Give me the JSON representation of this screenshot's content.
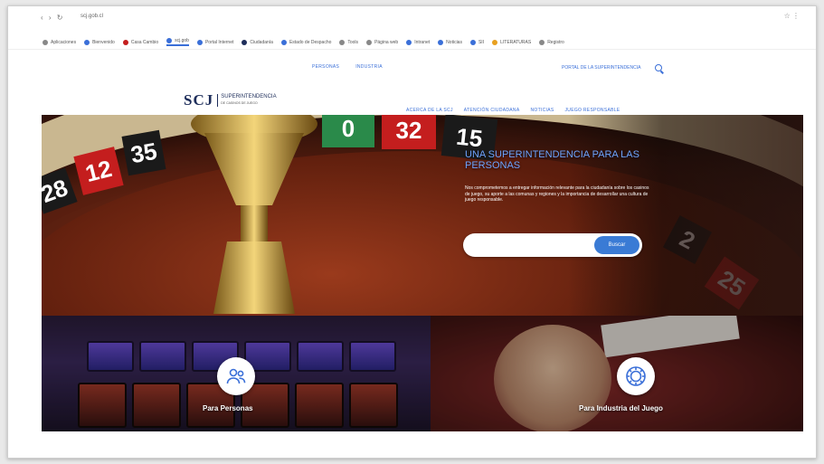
{
  "browser": {
    "nav_glyphs": "‹ › ↻",
    "url": "scj.gob.cl",
    "right_glyphs": "☆ ⋮",
    "bookmarks": [
      {
        "label": "Aplicaciones",
        "color": "#888888"
      },
      {
        "label": "Bienvenido",
        "color": "#3a6fd8"
      },
      {
        "label": "Casa Cambio",
        "color": "#c41e1e"
      },
      {
        "label": "scj.gob",
        "color": "#3a6fd8",
        "active": true
      },
      {
        "label": "Portal Internet",
        "color": "#3a6fd8"
      },
      {
        "label": "Ciudadanía",
        "color": "#1d2d5a"
      },
      {
        "label": "Estado de Despacho",
        "color": "#3a6fd8"
      },
      {
        "label": "Tools",
        "color": "#888888"
      },
      {
        "label": "Página web",
        "color": "#888888"
      },
      {
        "label": "Intranet",
        "color": "#3a6fd8"
      },
      {
        "label": "Noticias",
        "color": "#3a6fd8"
      },
      {
        "label": "SII",
        "color": "#3a6fd8"
      },
      {
        "label": "LITERATURAS",
        "color": "#e8a020"
      },
      {
        "label": "Registro",
        "color": "#888888"
      }
    ]
  },
  "header": {
    "topnav": [
      "PERSONAS",
      "INDUSTRIA"
    ],
    "topnav_right": "PORTAL DE LA SUPERINTENDENCIA",
    "logo_mark": "SCJ",
    "logo_text": "SUPERINTENDENCIA",
    "logo_sub": "DE CASINOS DE JUEGO",
    "mainnav": [
      "ACERCA DE LA SCJ",
      "ATENCIÓN CIUDADANA",
      "NOTICIAS",
      "JUEGO RESPONSABLE"
    ]
  },
  "hero": {
    "pockets": [
      "28",
      "12",
      "35",
      "0",
      "32",
      "15",
      "2",
      "25"
    ],
    "title": "UNA SUPERINTENDENCIA PARA LAS PERSONAS",
    "description": "Nos comprometemos a entregar información relevante para la ciudadanía sobre los casinos de juego, su aporte a las comunas y regiones y la importancia de desarrollar una cultura de juego responsable.",
    "search_placeholder": "",
    "search_button": "Buscar"
  },
  "cards": {
    "left_label": "Para Personas",
    "right_label": "Para Industria del Juego"
  },
  "colors": {
    "accent": "#3a6fd8",
    "button": "#3a7bd5",
    "brand": "#1d2d5a"
  }
}
